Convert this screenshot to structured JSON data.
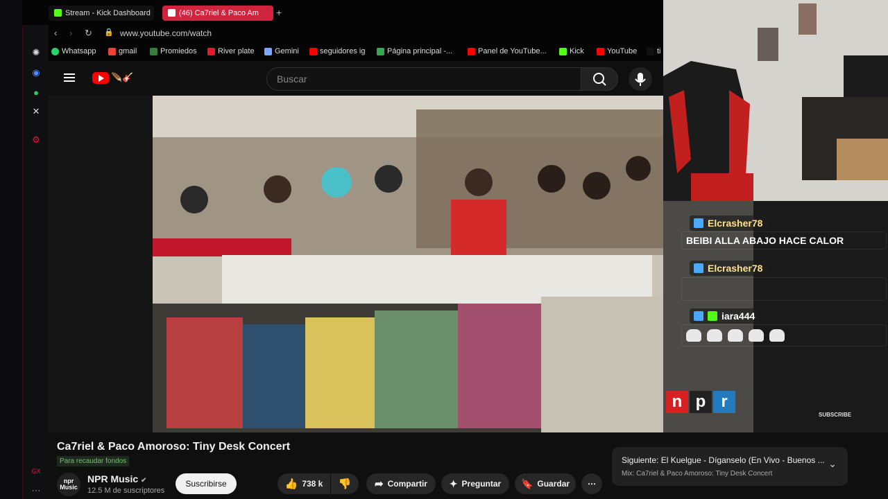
{
  "browser": {
    "tabs": [
      {
        "label": "Stream - Kick Dashboard",
        "favicon": "kick-favicon",
        "color": "#53fc18"
      },
      {
        "label": "(46) Ca7riel & Paco Am",
        "favicon": "youtube-favicon",
        "color": "#d0233d",
        "active": true
      }
    ],
    "new_tab_glyph": "+",
    "url": "www.youtube.com/watch",
    "bookmarks": [
      {
        "label": "Whatsapp",
        "color": "#25d366"
      },
      {
        "label": "gmail",
        "color": "#ea4335"
      },
      {
        "label": "Promiedos",
        "color": "#3a7d3a"
      },
      {
        "label": "River plate",
        "color": "#e21a2c"
      },
      {
        "label": "Gemini",
        "color": "#7aa7ff"
      },
      {
        "label": "seguidores ig",
        "color": "#ff0000"
      },
      {
        "label": "Página principal -...",
        "color": "#34a853"
      },
      {
        "label": "Panel de YouTube...",
        "color": "#ff0000"
      },
      {
        "label": "Kick",
        "color": "#53fc18"
      },
      {
        "label": "YouTube",
        "color": "#ff0000"
      },
      {
        "label": "ti",
        "color": "#ffffff"
      }
    ]
  },
  "youtube": {
    "search_placeholder": "Buscar",
    "video": {
      "title": "Ca7riel & Paco Amoroso: Tiny Desk Concert",
      "fundraiser_badge": "Para recaudar fondos",
      "npr_letters": [
        "n",
        "p",
        "r"
      ],
      "watermark": "SUBSCRIBE"
    },
    "channel": {
      "avatar_text": "npr\nMusic",
      "name": "NPR Music",
      "subscribers": "12.5 M de suscriptores",
      "subscribe_label": "Suscribirse"
    },
    "actions": {
      "likes": "738 k",
      "share": "Compartir",
      "ask": "Preguntar",
      "save": "Guardar"
    },
    "next": {
      "line1": "Siguiente: El Kuelgue - Díganselo (En Vivo - Buenos ...",
      "line2": "Mix: Ca7riel & Paco Amoroso: Tiny Desk Concert"
    }
  },
  "chat": [
    {
      "user": "Elcrasher78",
      "message": "BEIBI ALLA ABAJO HACE CALOR"
    },
    {
      "user": "Elcrasher78",
      "message": ""
    },
    {
      "user": "iara444",
      "message": ""
    }
  ],
  "colors": {
    "opera_red": "#d0233d",
    "youtube_red": "#ff0000",
    "kick_green": "#53fc18"
  }
}
